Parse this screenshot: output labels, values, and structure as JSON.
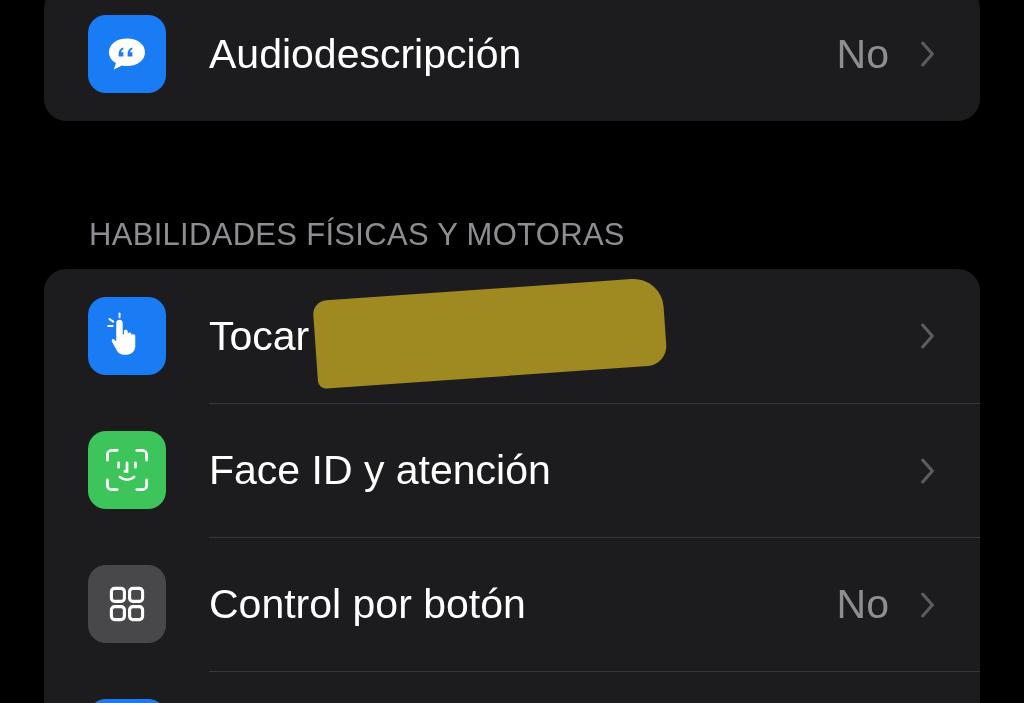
{
  "sections": [
    {
      "rows": [
        {
          "color": "#1a7cf5",
          "label": "Audiodescripción",
          "value": "No"
        }
      ]
    },
    {
      "header": "HABILIDADES FÍSICAS Y MOTORAS",
      "rows": [
        {
          "color": "#1a7cf5",
          "label": "Tocar",
          "highlighted": true
        },
        {
          "color": "#3dc45a",
          "label": "Face ID y atención"
        },
        {
          "color": "#48484a",
          "label": "Control por botón",
          "value": "No"
        },
        {
          "color": "#1a7cf5"
        }
      ]
    }
  ]
}
